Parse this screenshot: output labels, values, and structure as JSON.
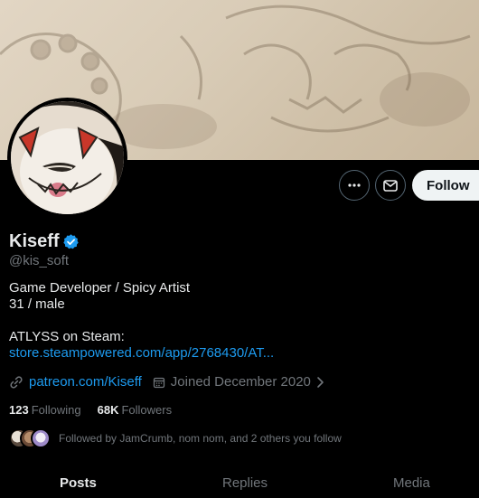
{
  "profile": {
    "display_name": "Kiseff",
    "handle": "@kis_soft",
    "bio_line1": "Game Developer / Spicy Artist",
    "bio_line2": "31 / male",
    "bio_line3": "ATLYSS on Steam:",
    "bio_link": "store.steampowered.com/app/2768430/AT...",
    "website": "patreon.com/Kiseff",
    "joined": "Joined December 2020"
  },
  "actions": {
    "follow_label": "Follow",
    "more_icon": "more-icon",
    "message_icon": "mail-icon"
  },
  "counts": {
    "following_num": "123",
    "following_label": "Following",
    "followers_num": "68K",
    "followers_label": "Followers"
  },
  "followed_by": "Followed by JamCrumb, nom nom, and 2 others you follow",
  "tabs": [
    "Posts",
    "Replies",
    "Media"
  ],
  "colors": {
    "accent": "#1d9bf0",
    "verified": "#1d9bf0",
    "muted": "#71767b",
    "text": "#e7e9ea"
  }
}
